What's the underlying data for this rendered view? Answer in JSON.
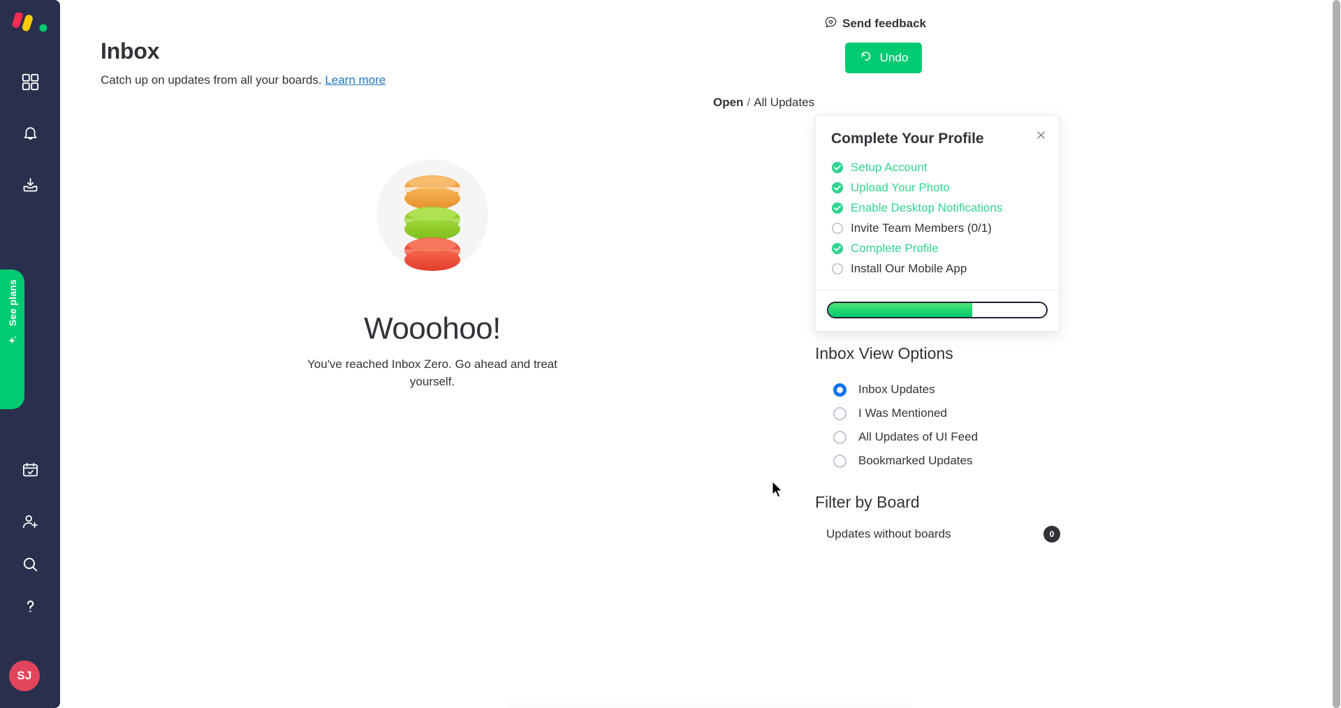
{
  "sidebar": {
    "logo": {
      "name": "monday-logo",
      "colors": [
        "#f62b54",
        "#ffcb00",
        "#00ca72"
      ]
    },
    "items": [
      {
        "name": "boards-icon",
        "label": "Boards"
      },
      {
        "name": "notifications-bell-icon",
        "label": "Notifications"
      },
      {
        "name": "inbox-tray-icon",
        "label": "Inbox"
      },
      {
        "name": "my-work-calendar-icon",
        "label": "My work"
      },
      {
        "name": "invite-members-icon",
        "label": "Invite members"
      },
      {
        "name": "search-icon",
        "label": "Search"
      },
      {
        "name": "help-icon",
        "label": "Help"
      }
    ],
    "see_plans": {
      "label": "See plans",
      "icon": "sparkle-icon",
      "color": "#00ca72"
    },
    "avatar": {
      "initials": "SJ",
      "color": "#e2445c"
    }
  },
  "header": {
    "title": "Inbox",
    "subtitle_text": "Catch up on updates from all your boards.",
    "learn_more_label": "Learn more",
    "send_feedback_label": "Send feedback",
    "undo_label": "Undo"
  },
  "breadcrumb": {
    "open_label": "Open",
    "separator": "/",
    "all_updates_label": "All Updates"
  },
  "empty_state": {
    "title": "Wooohoo!",
    "message": "You've reached Inbox Zero. Go ahead and treat yourself.",
    "illustration": "macaron-stack-illustration",
    "macaron_colors": [
      "#f0a03c",
      "#8fce30",
      "#f2563c"
    ]
  },
  "profile_card": {
    "title": "Complete Your Profile",
    "close_label": "Close",
    "done_color": "#33d391",
    "items": [
      {
        "label": "Setup Account",
        "done": true
      },
      {
        "label": "Upload Your Photo",
        "done": true
      },
      {
        "label": "Enable Desktop Notifications",
        "done": true
      },
      {
        "label": "Invite Team Members (0/1)",
        "done": false
      },
      {
        "label": "Complete Profile",
        "done": true
      },
      {
        "label": "Install Our Mobile App",
        "done": false
      }
    ],
    "progress_percent": 66
  },
  "inbox_view_options": {
    "title": "Inbox View Options",
    "selected": "Inbox Updates",
    "options": [
      {
        "label": "Inbox Updates",
        "selected": true
      },
      {
        "label": "I Was Mentioned",
        "selected": false
      },
      {
        "label": "All Updates of UI Feed",
        "selected": false
      },
      {
        "label": "Bookmarked Updates",
        "selected": false
      }
    ]
  },
  "filter_by_board": {
    "title": "Filter by Board",
    "rows": [
      {
        "label": "Updates without boards",
        "count": "0"
      }
    ]
  }
}
